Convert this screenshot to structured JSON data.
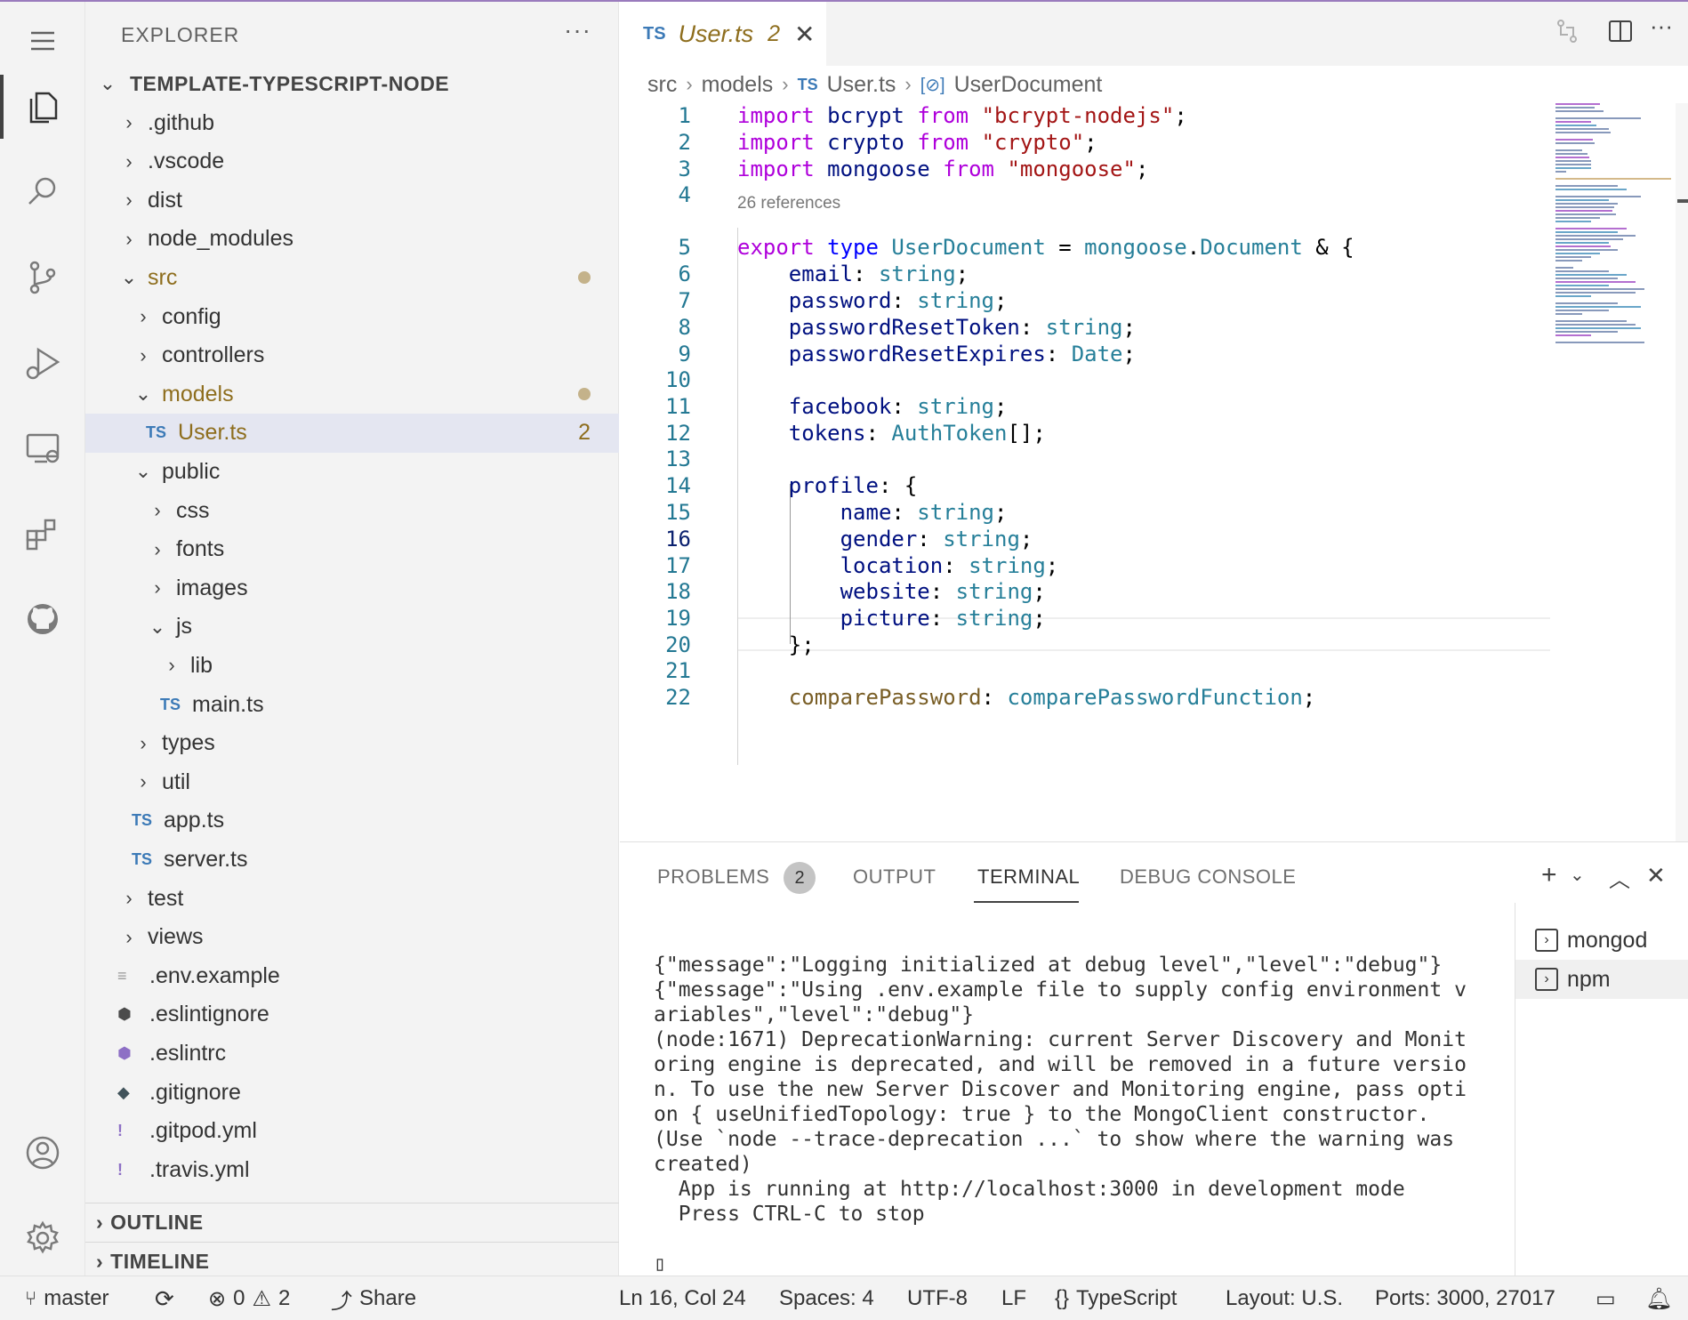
{
  "explorer": {
    "title": "EXPLORER",
    "more": "···",
    "root": "TEMPLATE-TYPESCRIPT-NODE",
    "items": [
      {
        "label": ".github",
        "kind": "folder",
        "open": false,
        "depth": 1
      },
      {
        "label": ".vscode",
        "kind": "folder",
        "open": false,
        "depth": 1
      },
      {
        "label": "dist",
        "kind": "folder",
        "open": false,
        "depth": 1
      },
      {
        "label": "node_modules",
        "kind": "folder",
        "open": false,
        "depth": 1
      },
      {
        "label": "src",
        "kind": "folder",
        "open": true,
        "depth": 1,
        "modified": true
      },
      {
        "label": "config",
        "kind": "folder",
        "open": false,
        "depth": 2
      },
      {
        "label": "controllers",
        "kind": "folder",
        "open": false,
        "depth": 2
      },
      {
        "label": "models",
        "kind": "folder",
        "open": true,
        "depth": 2,
        "modified": true
      },
      {
        "label": "User.ts",
        "kind": "ts",
        "depth": 3,
        "problems": "2",
        "selected": true
      },
      {
        "label": "public",
        "kind": "folder",
        "open": true,
        "depth": 2
      },
      {
        "label": "css",
        "kind": "folder",
        "open": false,
        "depth": 3
      },
      {
        "label": "fonts",
        "kind": "folder",
        "open": false,
        "depth": 3
      },
      {
        "label": "images",
        "kind": "folder",
        "open": false,
        "depth": 3
      },
      {
        "label": "js",
        "kind": "folder",
        "open": true,
        "depth": 3
      },
      {
        "label": "lib",
        "kind": "folder",
        "open": false,
        "depth": 4
      },
      {
        "label": "main.ts",
        "kind": "ts",
        "depth": 4
      },
      {
        "label": "types",
        "kind": "folder",
        "open": false,
        "depth": 2
      },
      {
        "label": "util",
        "kind": "folder",
        "open": false,
        "depth": 2
      },
      {
        "label": "app.ts",
        "kind": "ts",
        "depth": 2
      },
      {
        "label": "server.ts",
        "kind": "ts",
        "depth": 2
      },
      {
        "label": "test",
        "kind": "folder",
        "open": false,
        "depth": 1
      },
      {
        "label": "views",
        "kind": "folder",
        "open": false,
        "depth": 1
      },
      {
        "label": ".env.example",
        "kind": "env",
        "depth": 1
      },
      {
        "label": ".eslintignore",
        "kind": "eslint",
        "depth": 1
      },
      {
        "label": ".eslintrc",
        "kind": "eslintrc",
        "depth": 1
      },
      {
        "label": ".gitignore",
        "kind": "git",
        "depth": 1
      },
      {
        "label": ".gitpod.yml",
        "kind": "yml",
        "depth": 1
      },
      {
        "label": ".travis.yml",
        "kind": "yml",
        "depth": 1
      }
    ],
    "sections": [
      "OUTLINE",
      "TIMELINE"
    ]
  },
  "tab": {
    "icon": "TS",
    "name": "User.ts",
    "problems": "2"
  },
  "breadcrumb": [
    "src",
    "models",
    "User.ts",
    "UserDocument"
  ],
  "editor": {
    "refs_label": "26 references",
    "line_numbers": [
      "1",
      "2",
      "3",
      "4",
      "5",
      "6",
      "7",
      "8",
      "9",
      "10",
      "11",
      "12",
      "13",
      "14",
      "15",
      "16",
      "17",
      "18",
      "19",
      "20",
      "21",
      "22"
    ],
    "current_line": "16"
  },
  "panel": {
    "tabs": [
      "PROBLEMS",
      "OUTPUT",
      "TERMINAL",
      "DEBUG CONSOLE"
    ],
    "active_tab": "TERMINAL",
    "problems_count": "2",
    "terminal_output": "{\"message\":\"Logging initialized at debug level\",\"level\":\"debug\"}\n{\"message\":\"Using .env.example file to supply config environment v\nariables\",\"level\":\"debug\"}\n(node:1671) DeprecationWarning: current Server Discovery and Monit\noring engine is deprecated, and will be removed in a future versio\nn. To use the new Server Discover and Monitoring engine, pass opti\non { useUnifiedTopology: true } to the MongoClient constructor.\n(Use `node --trace-deprecation ...` to show where the warning was\ncreated)\n  App is running at http://localhost:3000 in development mode\n  Press CTRL-C to stop\n\n▯",
    "terminals": [
      "mongod",
      "npm"
    ]
  },
  "status": {
    "branch": "master",
    "errors": "0",
    "warnings": "2",
    "share": "Share",
    "position": "Ln 16, Col 24",
    "spaces": "Spaces: 4",
    "encoding": "UTF-8",
    "eol": "LF",
    "language": "TypeScript",
    "language_icon": "{}",
    "layout": "Layout: U.S.",
    "ports": "Ports: 3000, 27017"
  },
  "colors": {
    "accent_top": "#9a7bbd",
    "modified": "#8e6e1e",
    "ts_icon": "#3c7ab7"
  }
}
